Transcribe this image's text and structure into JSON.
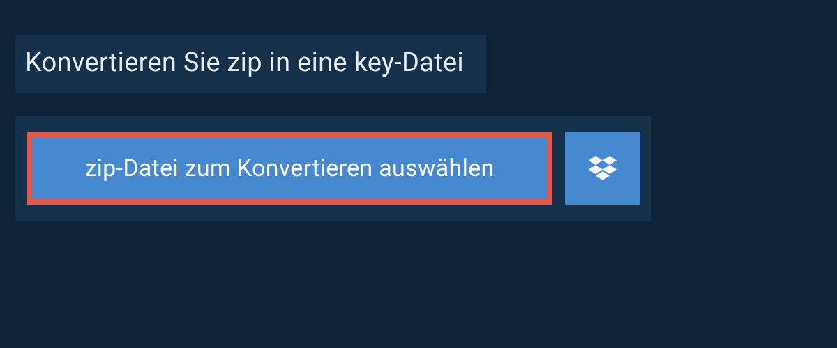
{
  "title": "Konvertieren Sie zip in eine key-Datei",
  "buttons": {
    "select_file_label": "zip-Datei zum Konvertieren auswählen"
  }
}
